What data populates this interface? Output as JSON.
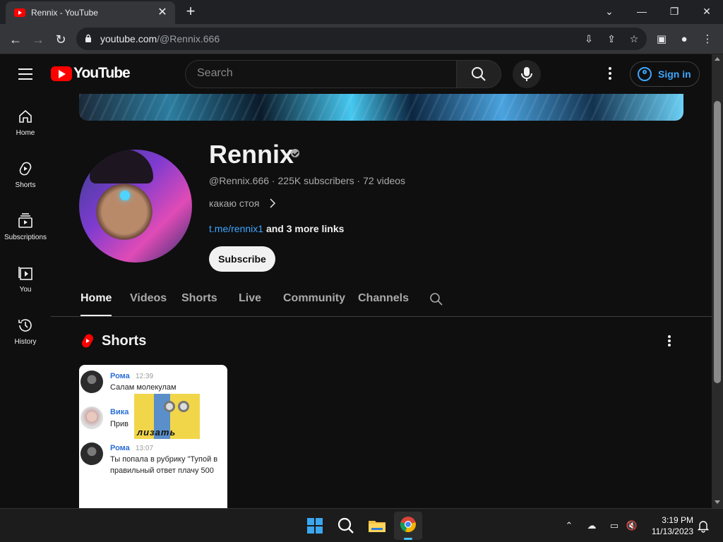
{
  "browser": {
    "tab_title": "Rennix - YouTube",
    "url_host": "youtube.com",
    "url_path": "/@Rennix.666"
  },
  "masthead": {
    "logo_text": "YouTube",
    "search_placeholder": "Search",
    "signin_label": "Sign in"
  },
  "guide": {
    "items": [
      {
        "label": "Home",
        "icon": "home-icon"
      },
      {
        "label": "Shorts",
        "icon": "shorts-icon"
      },
      {
        "label": "Subscriptions",
        "icon": "subscriptions-icon"
      },
      {
        "label": "You",
        "icon": "you-icon"
      },
      {
        "label": "History",
        "icon": "history-icon"
      }
    ]
  },
  "channel": {
    "name": "Rennix",
    "handle": "@Rennix.666",
    "subscribers": "225K subscribers",
    "videos": "72 videos",
    "description": "какаю стоя",
    "link": "t.me/rennix1",
    "more_links": "and 3 more links",
    "subscribe_label": "Subscribe"
  },
  "tabs": [
    "Home",
    "Videos",
    "Shorts",
    "Live",
    "Community",
    "Channels"
  ],
  "shorts_section": {
    "title": "Shorts",
    "card": {
      "messages": [
        {
          "name": "Рома",
          "time": "12:39",
          "text": "Салам молекулам"
        },
        {
          "name": "Вика",
          "time": "",
          "text": "Прив"
        },
        {
          "name": "Рома",
          "time": "13:07",
          "text": "Ты попала в рубрику \"Тупой в",
          "text2": "правильный ответ плачу 500"
        }
      ],
      "sticker_text": "лизать"
    }
  },
  "taskbar": {
    "time": "3:19 PM",
    "date": "11/13/2023"
  },
  "colors": {
    "accent_link": "#3ea6ff",
    "yt_red": "#ff0000",
    "background": "#0f0f0f"
  }
}
